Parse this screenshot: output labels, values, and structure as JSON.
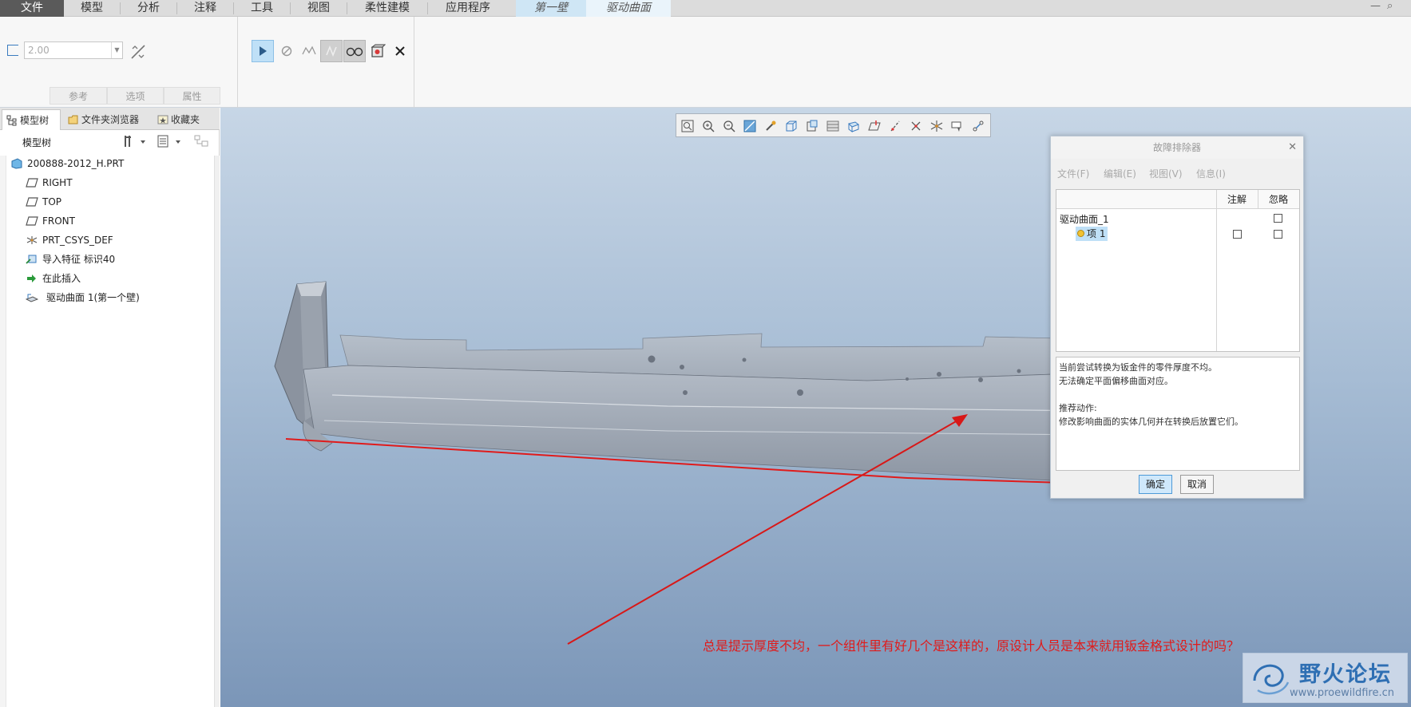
{
  "ribbon": {
    "tabs": [
      "文件",
      "模型",
      "分析",
      "注释",
      "工具",
      "视图",
      "柔性建模",
      "应用程序",
      "第一壁",
      "驱动曲面"
    ],
    "thickness_value": "2.00",
    "sub_tabs": [
      "参考",
      "选项",
      "属性"
    ]
  },
  "left_panel": {
    "tabs": [
      "模型树",
      "文件夹浏览器",
      "收藏夹"
    ],
    "header_title": "模型树",
    "tree": [
      {
        "label": "200888-2012_H.PRT",
        "icon": "part-icon"
      },
      {
        "label": "RIGHT",
        "icon": "datum-plane-icon"
      },
      {
        "label": "TOP",
        "icon": "datum-plane-icon"
      },
      {
        "label": "FRONT",
        "icon": "datum-plane-icon"
      },
      {
        "label": "PRT_CSYS_DEF",
        "icon": "csys-icon"
      },
      {
        "label": "导入特征 标识40",
        "icon": "import-feature-icon"
      },
      {
        "label": "在此插入",
        "icon": "insert-here-arrow-icon"
      },
      {
        "label": "驱动曲面 1(第一个壁)",
        "icon": "driving-surface-icon"
      }
    ]
  },
  "dialog": {
    "title": "故障排除器",
    "menu": [
      "文件(F)",
      "编辑(E)",
      "视图(V)",
      "信息(I)"
    ],
    "columns": [
      "注解",
      "忽略"
    ],
    "rows": [
      {
        "label": "驱动曲面_1",
        "annotate_checked": null,
        "ignore_checked": false
      },
      {
        "label": "项 1",
        "annotate_checked": false,
        "ignore_checked": false
      }
    ],
    "message_lines": [
      "当前尝试转换为钣金件的零件厚度不均。",
      "无法确定平面偏移曲面对应。",
      "",
      "推荐动作:",
      "修改影响曲面的实体几何并在转换后放置它们。"
    ],
    "ok_label": "确定",
    "cancel_label": "取消"
  },
  "annotation": "总是提示厚度不均，一个组件里有好几个是这样的，原设计人员是本来就用钣金格式设计的吗？",
  "watermark": {
    "name": "野火论坛",
    "url": "www.proewildfire.cn"
  },
  "colors": {
    "annotation": "#e01b1b",
    "accent": "#3a7bbf",
    "selected_item": "#bfe0f7"
  }
}
